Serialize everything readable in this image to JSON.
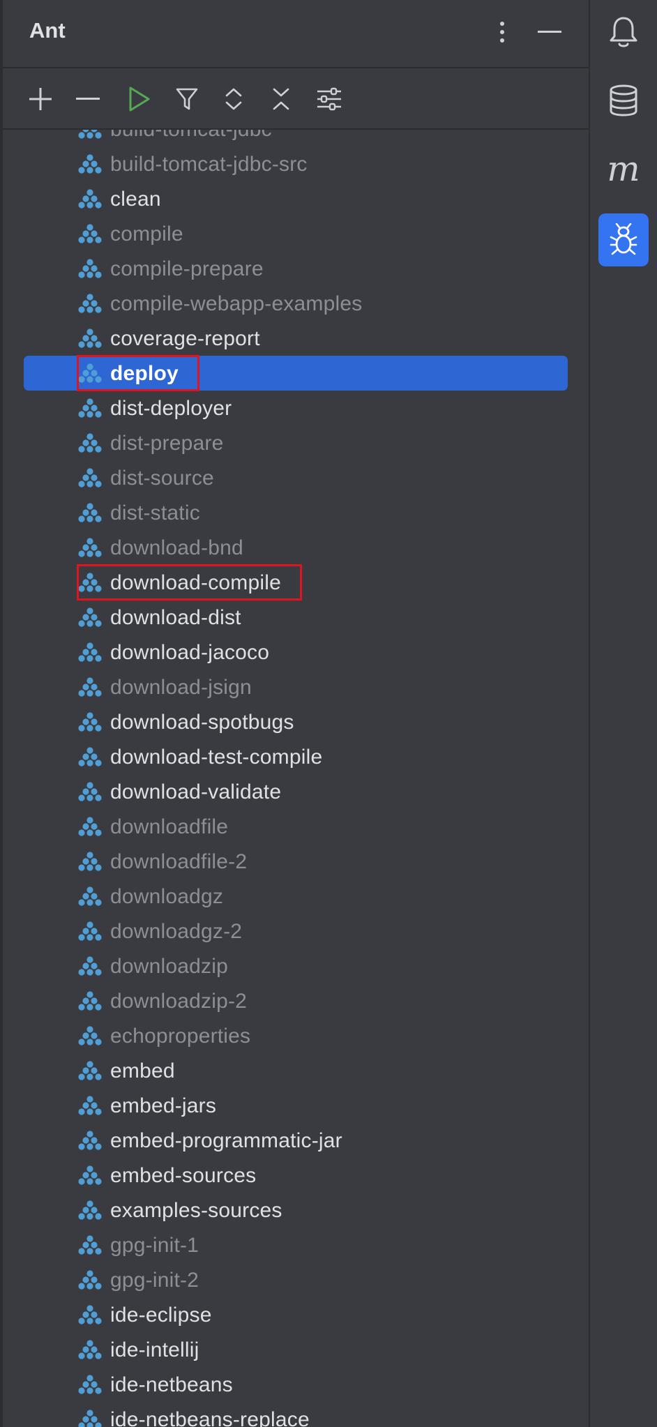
{
  "header": {
    "title": "Ant"
  },
  "toolbar": {
    "add": "add-icon",
    "remove": "remove-icon",
    "run": "run-icon",
    "filter": "filter-icon",
    "expand": "expand-all-icon",
    "collapse": "collapse-all-icon",
    "settings": "settings-icon"
  },
  "right_strip": {
    "items": [
      "notifications-icon",
      "database-icon",
      "maven-icon",
      "ant-icon"
    ],
    "active": "ant-icon",
    "maven_letter": "m"
  },
  "colors": {
    "panel_bg": "#393b40",
    "selection": "#2e67d3",
    "run_green": "#55a955",
    "ant_icon": "#4f9ed6",
    "highlight_box": "#e0141f",
    "text": "#dfe1e5",
    "text_dim": "#8c8f94"
  },
  "tree": {
    "items": [
      {
        "label": "build-tomcat-jdbc",
        "dim": true
      },
      {
        "label": "build-tomcat-jdbc-src",
        "dim": true
      },
      {
        "label": "clean",
        "dim": false
      },
      {
        "label": "compile",
        "dim": true
      },
      {
        "label": "compile-prepare",
        "dim": true
      },
      {
        "label": "compile-webapp-examples",
        "dim": true
      },
      {
        "label": "coverage-report",
        "dim": false
      },
      {
        "label": "deploy",
        "dim": false,
        "selected": true,
        "highlighted": true
      },
      {
        "label": "dist-deployer",
        "dim": false
      },
      {
        "label": "dist-prepare",
        "dim": true
      },
      {
        "label": "dist-source",
        "dim": true
      },
      {
        "label": "dist-static",
        "dim": true
      },
      {
        "label": "download-bnd",
        "dim": true
      },
      {
        "label": "download-compile",
        "dim": false,
        "highlighted": true
      },
      {
        "label": "download-dist",
        "dim": false
      },
      {
        "label": "download-jacoco",
        "dim": false
      },
      {
        "label": "download-jsign",
        "dim": true
      },
      {
        "label": "download-spotbugs",
        "dim": false
      },
      {
        "label": "download-test-compile",
        "dim": false
      },
      {
        "label": "download-validate",
        "dim": false
      },
      {
        "label": "downloadfile",
        "dim": true
      },
      {
        "label": "downloadfile-2",
        "dim": true
      },
      {
        "label": "downloadgz",
        "dim": true
      },
      {
        "label": "downloadgz-2",
        "dim": true
      },
      {
        "label": "downloadzip",
        "dim": true
      },
      {
        "label": "downloadzip-2",
        "dim": true
      },
      {
        "label": "echoproperties",
        "dim": true
      },
      {
        "label": "embed",
        "dim": false
      },
      {
        "label": "embed-jars",
        "dim": false
      },
      {
        "label": "embed-programmatic-jar",
        "dim": false
      },
      {
        "label": "embed-sources",
        "dim": false
      },
      {
        "label": "examples-sources",
        "dim": false
      },
      {
        "label": "gpg-init-1",
        "dim": true
      },
      {
        "label": "gpg-init-2",
        "dim": true
      },
      {
        "label": "ide-eclipse",
        "dim": false
      },
      {
        "label": "ide-intellij",
        "dim": false
      },
      {
        "label": "ide-netbeans",
        "dim": false
      },
      {
        "label": "ide-netbeans-replace",
        "dim": false
      }
    ]
  }
}
